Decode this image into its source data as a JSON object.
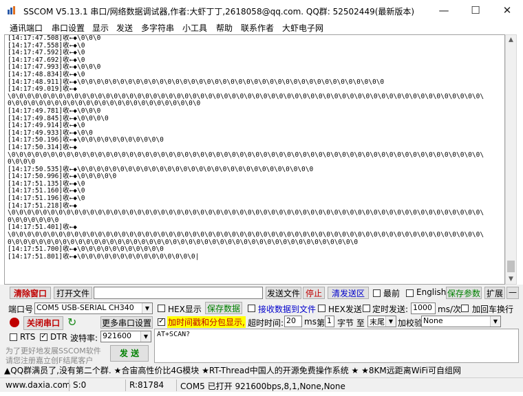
{
  "window": {
    "title": "SSCOM V5.13.1 串口/网络数据调试器,作者:大虾丁丁,2618058@qq.com. QQ群: 52502449(最新版本)",
    "min_glyph": "—",
    "max_glyph": "☐",
    "close_glyph": "✕"
  },
  "menu": [
    "通讯端口",
    "串口设置",
    "显示",
    "发送",
    "多字符串",
    "小工具",
    "帮助",
    "联系作者",
    "大虾电子网"
  ],
  "output_lines": [
    "[14:17:47.508]收←◆\\0\\0\\0",
    "[14:17:47.558]收←◆\\0",
    "[14:17:47.592]收←◆\\0",
    "[14:17:47.692]收←◆\\0",
    "[14:17:47.993]收←◆\\0\\0\\0",
    "[14:17:48.834]收←◆\\0",
    "[14:17:48.911]收←◆\\0\\0\\0\\0\\0\\0\\0\\0\\0\\0\\0\\0\\0\\0\\0\\0\\0\\0\\0\\0\\0\\0\\0\\0\\0\\0\\0\\0\\0\\0\\0\\0\\0\\0\\0\\0\\0\\0\\0",
    "[14:17:49.019]收←◆",
    "\\0\\0\\0\\0\\0\\0\\0\\0\\0\\0\\0\\0\\0\\0\\0\\0\\0\\0\\0\\0\\0\\0\\0\\0\\0\\0\\0\\0\\0\\0\\0\\0\\0\\0\\0\\0\\0\\0\\0\\0\\0\\0\\0\\0\\0\\0\\0\\0\\0\\0\\0\\0\\0\\0\\0\\0\\0\\0\\0\\0\\",
    "0\\0\\0\\0\\0\\0\\0\\0\\0\\0\\0\\0\\0\\0\\0\\0\\0\\0\\0\\0\\0\\0\\0\\0\\0",
    "[14:17:49.781]收←◆\\0\\0\\0",
    "[14:17:49.845]收←◆\\0\\0\\0\\0",
    "[14:17:49.914]收←◆\\0",
    "[14:17:49.933]收←◆\\0\\0",
    "[14:17:50.196]收←◆\\0\\0\\0\\0\\0\\0\\0\\0\\0\\0\\0",
    "[14:17:50.314]收←◆",
    "\\0\\0\\0\\0\\0\\0\\0\\0\\0\\0\\0\\0\\0\\0\\0\\0\\0\\0\\0\\0\\0\\0\\0\\0\\0\\0\\0\\0\\0\\0\\0\\0\\0\\0\\0\\0\\0\\0\\0\\0\\0\\0\\0\\0\\0\\0\\0\\0\\0\\0\\0\\0\\0\\0\\0\\0\\0\\0\\0\\0\\",
    "0\\0\\0\\0",
    "[14:17:50.535]收←◆\\0\\0\\0\\0\\0\\0\\0\\0\\0\\0\\0\\0\\0\\0\\0\\0\\0\\0\\0\\0\\0\\0\\0\\0\\0\\0\\0\\0\\0\\0",
    "[14:17:50.996]收←◆\\0\\0\\0\\0\\0",
    "[14:17:51.135]收←◆\\0",
    "[14:17:51.160]收←◆\\0",
    "[14:17:51.196]收←◆\\0",
    "[14:17:51.218]收←◆",
    "\\0\\0\\0\\0\\0\\0\\0\\0\\0\\0\\0\\0\\0\\0\\0\\0\\0\\0\\0\\0\\0\\0\\0\\0\\0\\0\\0\\0\\0\\0\\0\\0\\0\\0\\0\\0\\0\\0\\0\\0\\0\\0\\0\\0\\0\\0\\0\\0\\0\\0\\0\\0\\0\\0\\0\\0\\0\\0\\0\\0\\",
    "0\\0\\0\\0\\0\\0\\0",
    "[14:17:51.401]收←◆",
    "\\0\\0\\0\\0\\0\\0\\0\\0\\0\\0\\0\\0\\0\\0\\0\\0\\0\\0\\0\\0\\0\\0\\0\\0\\0\\0\\0\\0\\0\\0\\0\\0\\0\\0\\0\\0\\0\\0\\0\\0\\0\\0\\0\\0\\0\\0\\0\\0\\0\\0\\0\\0\\0\\0\\0\\0\\0\\0\\0\\0\\",
    "0\\0\\0\\0\\0\\0\\0\\0\\0\\0\\0\\0\\0\\0\\0\\0\\0\\0\\0\\0\\0\\0\\0\\0\\0\\0\\0\\0\\0\\0\\0\\0\\0\\0\\0\\0\\0\\0\\0\\0\\0\\0\\0\\0\\0",
    "[14:17:51.700]收←◆\\0\\0\\0\\0\\0\\0\\0\\0\\0\\0\\0",
    "[14:17:51.801]收←◆\\0\\0\\0\\0\\0\\0\\0\\0\\0\\0\\0\\0\\0\\0\\0|"
  ],
  "toolbar": {
    "clear_window": "清除窗口",
    "open_file": "打开文件",
    "send_file": "发送文件",
    "stop": "停止",
    "clear_send": "清发送区",
    "last": "最前",
    "english": "English",
    "save_params": "保存参数",
    "expand": "扩展",
    "collapse": "—"
  },
  "port": {
    "label": "端口号",
    "value": "COM5 USB-SERIAL CH340",
    "hex_display": "HEX显示",
    "save_data": "保存数据",
    "recv_to_file": "接收数据到文件",
    "hex_send": "HEX发送",
    "timed_send": "定时发送:",
    "interval": "1000",
    "interval_unit": "ms/次",
    "add_crlf": "加回车换行"
  },
  "serial": {
    "close_port": "关闭串口",
    "more_settings": "更多串口设置",
    "timestamp": "加时间戳和分包显示,",
    "timeout_label": "超时时间:",
    "timeout": "20",
    "timeout_unit": "ms",
    "nth": "第",
    "byte_no": "1",
    "byte_to": "字节 至",
    "end": "末尾",
    "checksum_label": "加校验",
    "checksum": "None",
    "rts": "RTS",
    "dtr": "DTR",
    "baud_label": "波特率:",
    "baud": "921600",
    "send": "发 送",
    "promo_line1": "为了更好地发展SSCOM软件",
    "promo_line2": "请您注册嘉立创F结尾客户"
  },
  "send_text": "AT+SCAN?",
  "ad": "▲QQ群满员了,没有第二个群. ★合宙高性价比4G模块 ★RT-Thread中国人的开源免费操作系统 ★ ★8KM远距离WiFi可自组网",
  "status": {
    "site": "www.daxia.com",
    "sent": "S:0",
    "received": "R:81784",
    "port_state": "COM5 已打开  921600bps,8,1,None,None"
  },
  "colors": {
    "red": "#c00000",
    "green": "#008000",
    "blue": "#0000cc",
    "timestamp_bg": "#ffff00",
    "panel": "#f0f0f0"
  }
}
